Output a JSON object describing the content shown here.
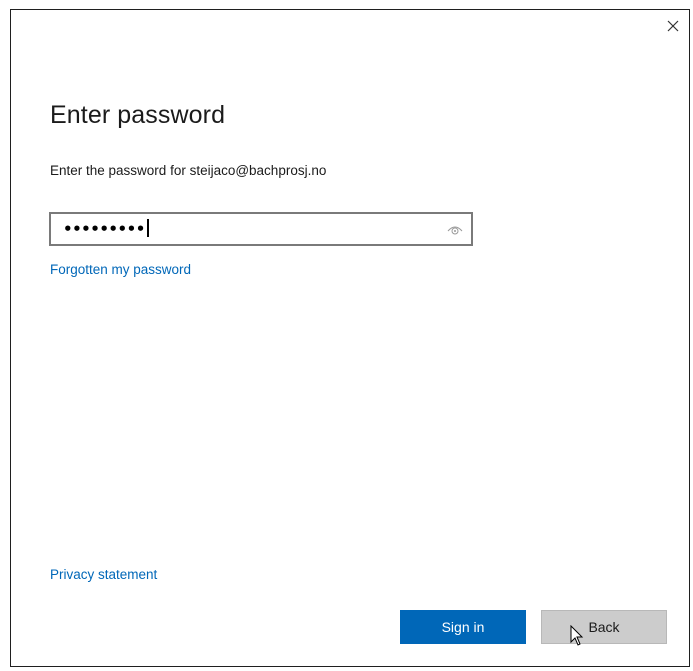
{
  "dialog": {
    "close_label": "×",
    "title": "Enter password",
    "subtitle": "Enter the password for steijaco@bachprosj.no"
  },
  "password_field": {
    "masked_value": "•••••••••",
    "icon": "eye-reveal-icon"
  },
  "links": {
    "forgot": "Forgotten my password",
    "privacy": "Privacy statement"
  },
  "buttons": {
    "sign_in": "Sign in",
    "back": "Back"
  },
  "colors": {
    "accent": "#0067b8",
    "secondary_button": "#cccccc"
  }
}
